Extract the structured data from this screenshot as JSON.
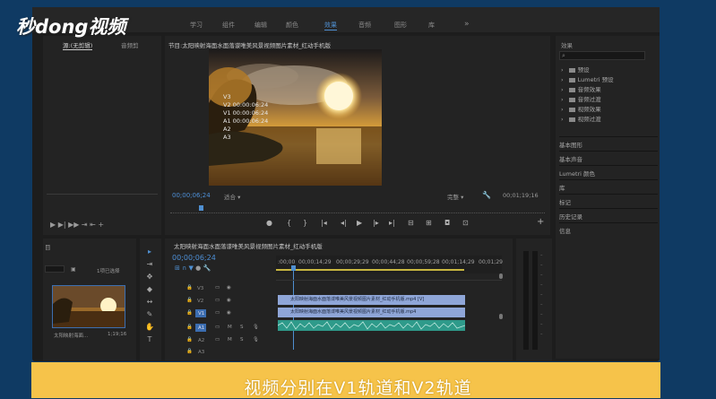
{
  "logo": {
    "text": "秒dong视频"
  },
  "workspace_tabs": [
    "学习",
    "组件",
    "编辑",
    "颜色",
    "效果",
    "音频",
    "图形",
    "库"
  ],
  "workspace_active": 4,
  "more_glyph": "»",
  "source_panel": {
    "tab1": "源:(无剪辑)",
    "tab2": "音频剪"
  },
  "program": {
    "title": "节目:太阳映射海面水面落谍唯美风景视频图片素材_红动手机版",
    "overlay_lines": [
      "V3",
      "V2 00:00:06:24",
      "V1 00:00:06:24",
      "A1 00:00:06:24",
      "A2",
      "A3"
    ],
    "timecode": "00;00;06;24",
    "fit": "适合",
    "quality": "完整",
    "duration": "00;01;19;16"
  },
  "effects": {
    "title": "效果",
    "search_icon": "magnifier",
    "items": [
      "预设",
      "Lumetri 预设",
      "音频效果",
      "音频过渡",
      "视频效果",
      "视频过渡"
    ],
    "sections": [
      "基本图形",
      "基本声音",
      "Lumetri 颜色",
      "库",
      "标记",
      "历史记录",
      "信息"
    ]
  },
  "project": {
    "title": "目",
    "selected_text": "1项已选择",
    "clip_name": "太阳映射海面...",
    "clip_duration": "1;19;16"
  },
  "timeline": {
    "title": "太阳映射海面水面落谍唯美风景视频图片素材_红动手机版",
    "timecode": "00;00;06;24",
    "ruler": [
      ":00;00",
      "00;00;14;29",
      "00;00;29;29",
      "00;00;44;28",
      "00;00;59;28",
      "00;01;14;29",
      "00;01;29"
    ],
    "video_tracks": [
      "V3",
      "V2",
      "V1"
    ],
    "audio_tracks": [
      "A1",
      "A2",
      "A3"
    ],
    "track_buttons": {
      "mute": "M",
      "solo": "S"
    },
    "clip_v2": "太阳映射海面水面落谍唯美风景视频图片素材_红动手机版.mp4 [V]",
    "clip_v1": "太阳映射海面水面落谍唯美风景视频图片素材_红动手机版.mp4"
  },
  "caption": "视频分别在V1轨道和V2轨道",
  "colors": {
    "accent": "#4f8fd0",
    "clip_video": "#8fa6d8",
    "clip_audio": "#2e9a8a",
    "caption_bg": "#f6c34a",
    "outer_bg": "#0f3a63"
  }
}
